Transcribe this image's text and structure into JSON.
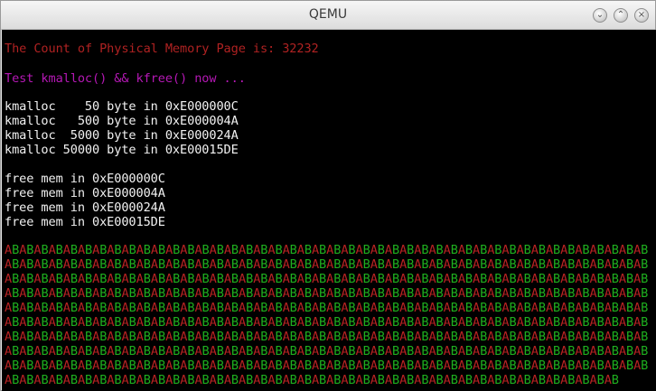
{
  "window": {
    "title": "QEMU"
  },
  "console": {
    "line_memory": "The Count of Physical Memory Page is: 32232",
    "line_test": "Test kmalloc() && kfree() now ...",
    "kmalloc_lines": [
      "kmalloc    50 byte in 0xE000000C",
      "kmalloc   500 byte in 0xE000004A",
      "kmalloc  5000 byte in 0xE000024A",
      "kmalloc 50000 byte in 0xE00015DE"
    ],
    "free_lines": [
      "free mem in 0xE000000C",
      "free mem in 0xE000004A",
      "free mem in 0xE000024A",
      "free mem in 0xE00015DE"
    ],
    "ab_pattern": {
      "text": "ABABABABABABABABABABABABABABABABABABABABABABABABABABABABABABABABABABABABABABABABABABABAB",
      "last_row": "ABABABABABABABABABABABABABABABABABABABABABABABABABABABABABABABABABABABABABABABABABAB",
      "rows": 10,
      "color_a": "#b52222",
      "color_b": "#1fae1f"
    }
  },
  "colors": {
    "memory_text": "#b02222",
    "test_text": "#b518b5",
    "normal_text": "#f2f2f2",
    "screen_bg": "#000000"
  }
}
